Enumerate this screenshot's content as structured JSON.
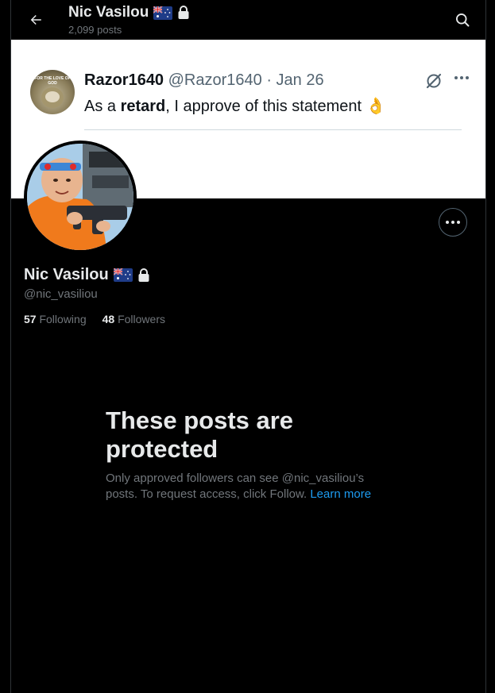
{
  "header": {
    "title": "Nic Vasilou",
    "post_count": "2,099 posts"
  },
  "banner": {
    "avatar_text": "FOR THE LOVE OF GOD",
    "user_name": "Razor1640",
    "meta": " @Razor1640 · Jan 26",
    "text_pre": "As a ",
    "text_bold": "retard",
    "text_post": ", I approve of this statement ",
    "emoji": "👌"
  },
  "profile": {
    "name": "Nic Vasilou",
    "handle": "@nic_vasiliou",
    "following_count": "57",
    "following_label": "Following",
    "followers_count": "48",
    "followers_label": "Followers"
  },
  "protected": {
    "title": "These posts are protected",
    "desc": "Only approved followers can see @nic_vasiliou’s posts. To request access, click Follow. ",
    "link": "Learn more"
  },
  "colors": {
    "background": "#000000",
    "text_primary": "#e7e9ea",
    "text_secondary": "#71767b",
    "link": "#1d9bf0"
  }
}
